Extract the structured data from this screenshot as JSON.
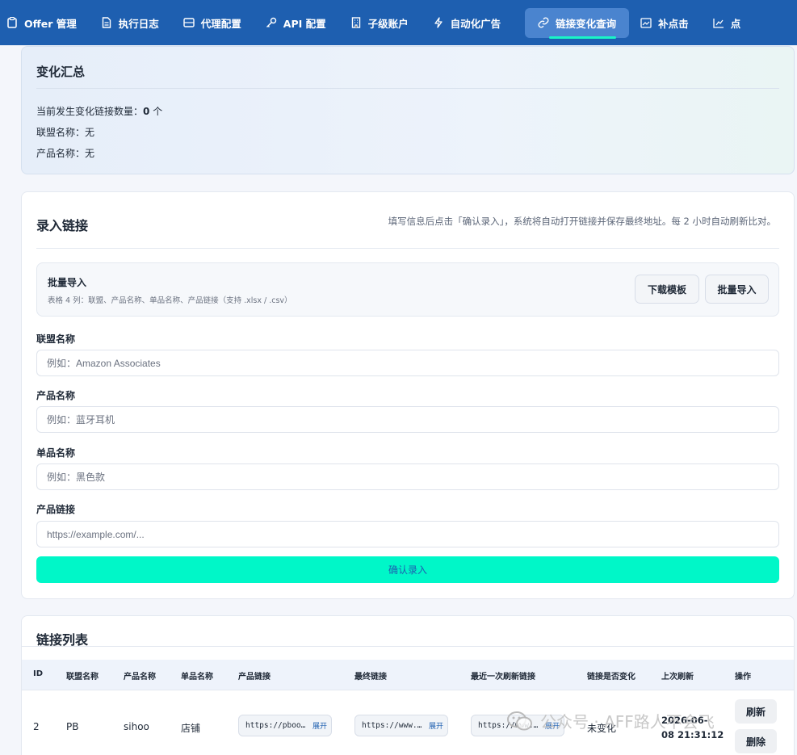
{
  "nav": {
    "items": [
      {
        "label": "Offer 管理",
        "icon": "clipboard-icon"
      },
      {
        "label": "执行日志",
        "icon": "document-icon"
      },
      {
        "label": "代理配置",
        "icon": "server-icon"
      },
      {
        "label": "API 配置",
        "icon": "key-icon"
      },
      {
        "label": "子级账户",
        "icon": "building-icon"
      },
      {
        "label": "自动化广告",
        "icon": "lightning-icon"
      },
      {
        "label": "链接变化查询",
        "icon": "link-icon",
        "active": true
      },
      {
        "label": "补点击",
        "icon": "image-icon"
      },
      {
        "label": "点",
        "icon": "chart-icon"
      }
    ]
  },
  "summary": {
    "title": "变化汇总",
    "changed_label": "当前发生变化链接数量：",
    "changed_count": "0",
    "changed_unit": " 个",
    "alliance": "联盟名称：无",
    "product": "产品名称：无"
  },
  "entry": {
    "title": "录入链接",
    "hint": "填写信息后点击「确认录入」，系统将自动打开链接并保存最终地址。每 2 小时自动刷新比对。",
    "batch": {
      "title": "批量导入",
      "subtitle": "表格 4 列：联盟、产品名称、单品名称、产品链接（支持 .xlsx / .csv）",
      "download_label": "下载模板",
      "import_label": "批量导入"
    },
    "fields": {
      "alliance": {
        "label": "联盟名称",
        "placeholder": "例如：Amazon Associates"
      },
      "product": {
        "label": "产品名称",
        "placeholder": "例如：蓝牙耳机"
      },
      "item": {
        "label": "单品名称",
        "placeholder": "例如：黑色款"
      },
      "link": {
        "label": "产品链接",
        "placeholder": "https://example.com/..."
      }
    },
    "confirm_label": "确认录入"
  },
  "list": {
    "title": "链接列表",
    "headers": [
      "ID",
      "联盟名称",
      "产品名称",
      "单品名称",
      "产品链接",
      "最终链接",
      "最近一次刷新链接",
      "链接是否变化",
      "上次刷新",
      "操作"
    ],
    "rows": [
      {
        "id": "2",
        "alliance": "PB",
        "product": "sihoo",
        "item": "店铺",
        "product_link": "https://pboost…",
        "final_link": "https://www.am…",
        "recent_link": "https://www.am…",
        "expand": "展开",
        "changed": "未变化",
        "refresh_date": "2026-06-",
        "refresh_time": "08 21:31:12",
        "refresh_btn": "刷新",
        "delete_btn": "删除"
      }
    ]
  },
  "watermark": {
    "text": "公众号 · AFF路人不会飞"
  }
}
